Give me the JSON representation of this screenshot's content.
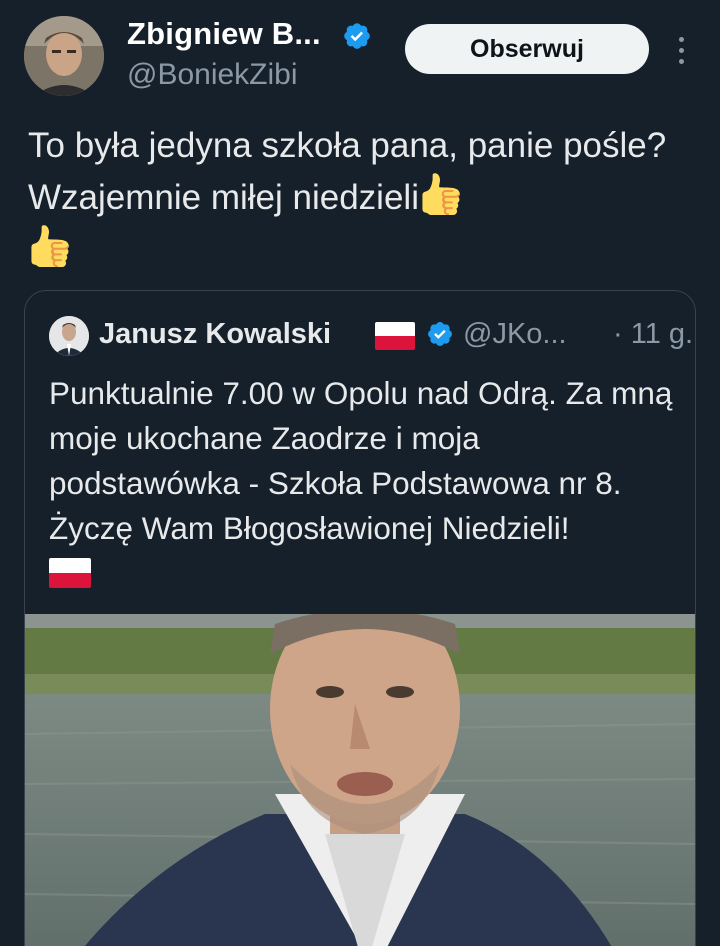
{
  "tweet": {
    "author_name": "Zbigniew B...",
    "author_handle": "@BoniekZibi",
    "follow_label": "Obserwuj",
    "text_part1": "To była jedyna szkoła pana, panie pośle?  Wzajemnie miłej niedzieli",
    "emoji": "thumbs-up"
  },
  "quoted": {
    "author_name": "Janusz Kowalski",
    "author_handle": "@JKo...",
    "time": "· 11 g.",
    "text": "Punktualnie 7.00 w Opolu nad Odrą. Za mną moje ukochane Zaodrze i moja podstawówka - Szkoła Podstawowa nr 8. Życzę Wam Błogosławionej Niedzieli!",
    "flag": "poland-flag"
  },
  "colors": {
    "background": "#15202b",
    "verified": "#1d9bf0",
    "muted": "#8b98a5",
    "border": "#38444d"
  }
}
